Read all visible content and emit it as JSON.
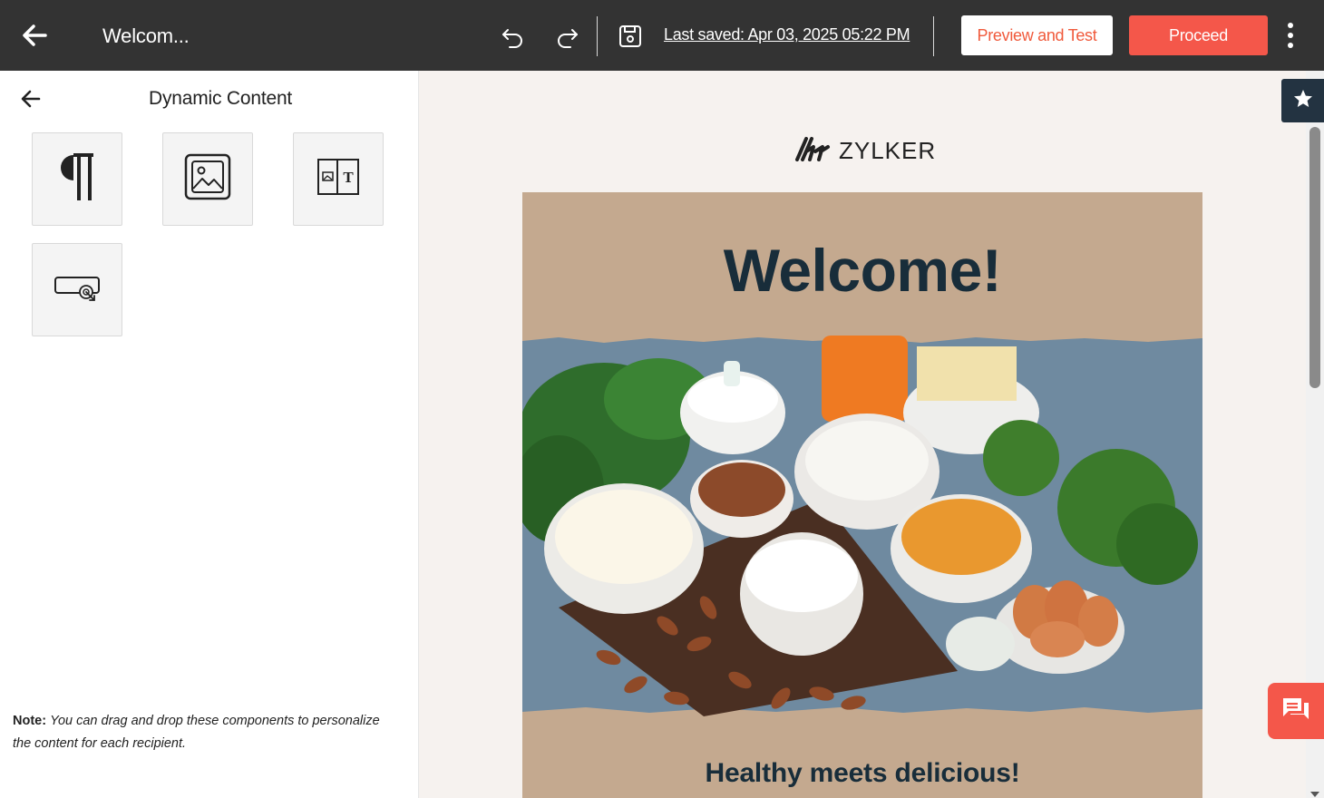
{
  "header": {
    "title": "Welcom...",
    "last_saved": "Last saved: Apr 03, 2025 05:22 PM",
    "preview_label": "Preview and Test",
    "proceed_label": "Proceed"
  },
  "sidebar": {
    "title": "Dynamic Content",
    "components": [
      {
        "name": "text-component",
        "icon": "paragraph-icon"
      },
      {
        "name": "image-component",
        "icon": "image-icon"
      },
      {
        "name": "image-text-component",
        "icon": "image-text-icon"
      },
      {
        "name": "button-component",
        "icon": "button-click-icon"
      }
    ],
    "note_label": "Note:",
    "note_text": "You can drag and drop these components to personalize the content for each recipient."
  },
  "email": {
    "logo_text": "ZYLKER",
    "heading": "Welcome!",
    "subheading": "Healthy meets delicious!"
  },
  "colors": {
    "topbar": "#333333",
    "accent": "#f4574a",
    "email_bg": "#c4a98f",
    "heading": "#182d3a"
  }
}
